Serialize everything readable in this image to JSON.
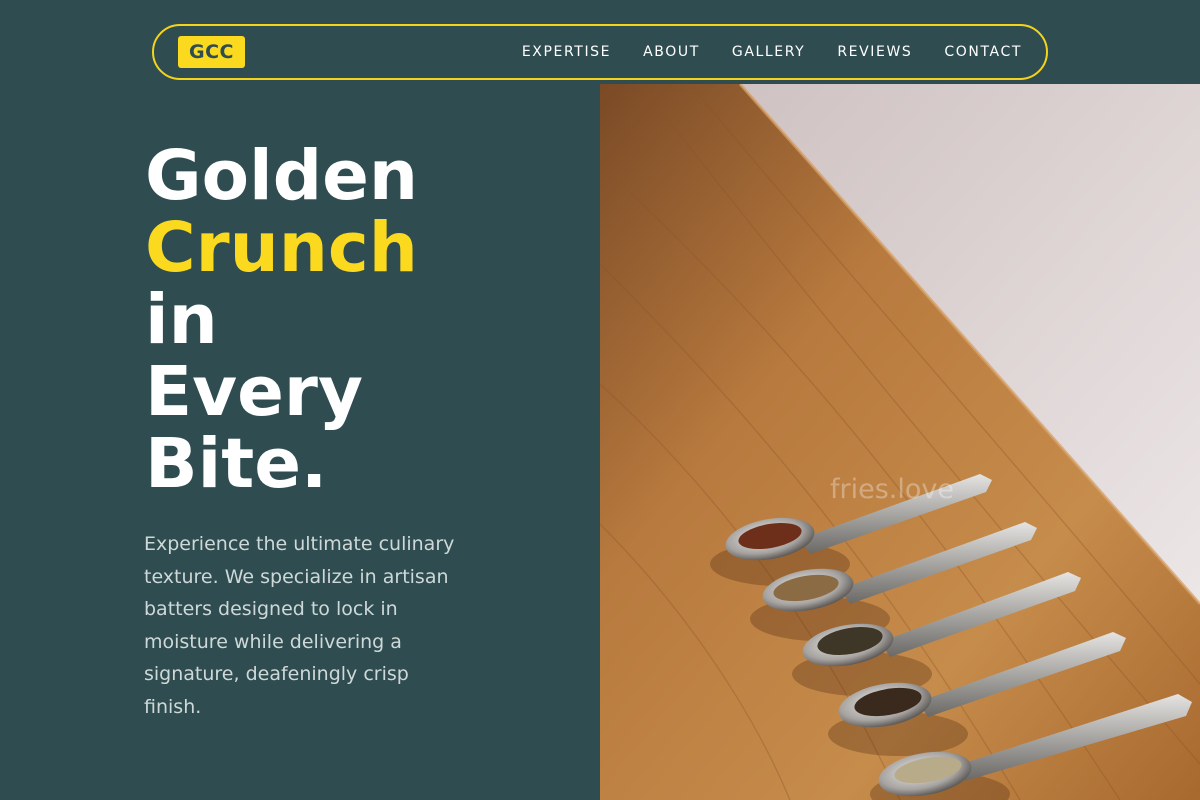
{
  "brand": {
    "logo": "GCC",
    "accent_color": "#fbd91e",
    "background_color": "#2f4d50"
  },
  "nav": {
    "items": [
      {
        "label": "EXPERTISE"
      },
      {
        "label": "ABOUT"
      },
      {
        "label": "GALLERY"
      },
      {
        "label": "REVIEWS"
      },
      {
        "label": "CONTACT"
      }
    ]
  },
  "hero": {
    "headline": {
      "line1": "Golden",
      "line2": "Crunch",
      "line3": "in",
      "line4": "Every",
      "line5": "Bite."
    },
    "description": "Experience the ultimate culinary texture. We specialize in artisan batters designed to lock in moisture while delivering a signature, deafeningly crisp finish."
  },
  "image": {
    "watermark": "fries.love",
    "alt": "Five metal spoons holding dried spices on a wooden table"
  }
}
